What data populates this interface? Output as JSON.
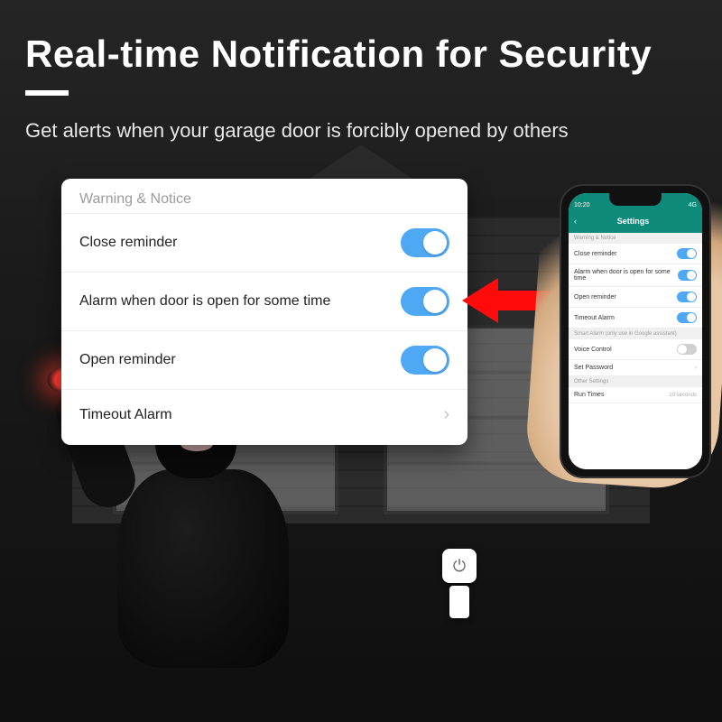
{
  "hero": {
    "title": "Real-time Notification for Security",
    "subtitle": "Get alerts when your garage door is forcibly opened by others"
  },
  "card": {
    "section_title": "Warning & Notice",
    "rows": [
      {
        "label": "Close reminder",
        "toggle": true
      },
      {
        "label": "Alarm when door is open for some time",
        "toggle": true
      },
      {
        "label": "Open reminder",
        "toggle": true
      },
      {
        "label": "Timeout Alarm",
        "chevron": true
      }
    ]
  },
  "phone": {
    "status": {
      "time": "10:20",
      "right": "4G"
    },
    "appbar": {
      "back": "‹",
      "title": "Settings"
    },
    "sections": [
      {
        "header": "Warning & Notice",
        "rows": [
          {
            "label": "Close reminder",
            "toggle": "on"
          },
          {
            "label": "Alarm when door is open for some time",
            "toggle": "on"
          },
          {
            "label": "Open reminder",
            "toggle": "on"
          },
          {
            "label": "Timeout Alarm",
            "toggle": "on"
          }
        ]
      },
      {
        "header": "Smart Alarm (only use in Google assistant)",
        "rows": [
          {
            "label": "Voice Control",
            "toggle": "off"
          },
          {
            "label": "Set Password",
            "chevron": true
          }
        ]
      },
      {
        "header": "Other Settings",
        "rows": [
          {
            "label": "Run Times",
            "value": "10 seconds"
          }
        ]
      }
    ]
  },
  "arrow_color": "#ff0b0b"
}
